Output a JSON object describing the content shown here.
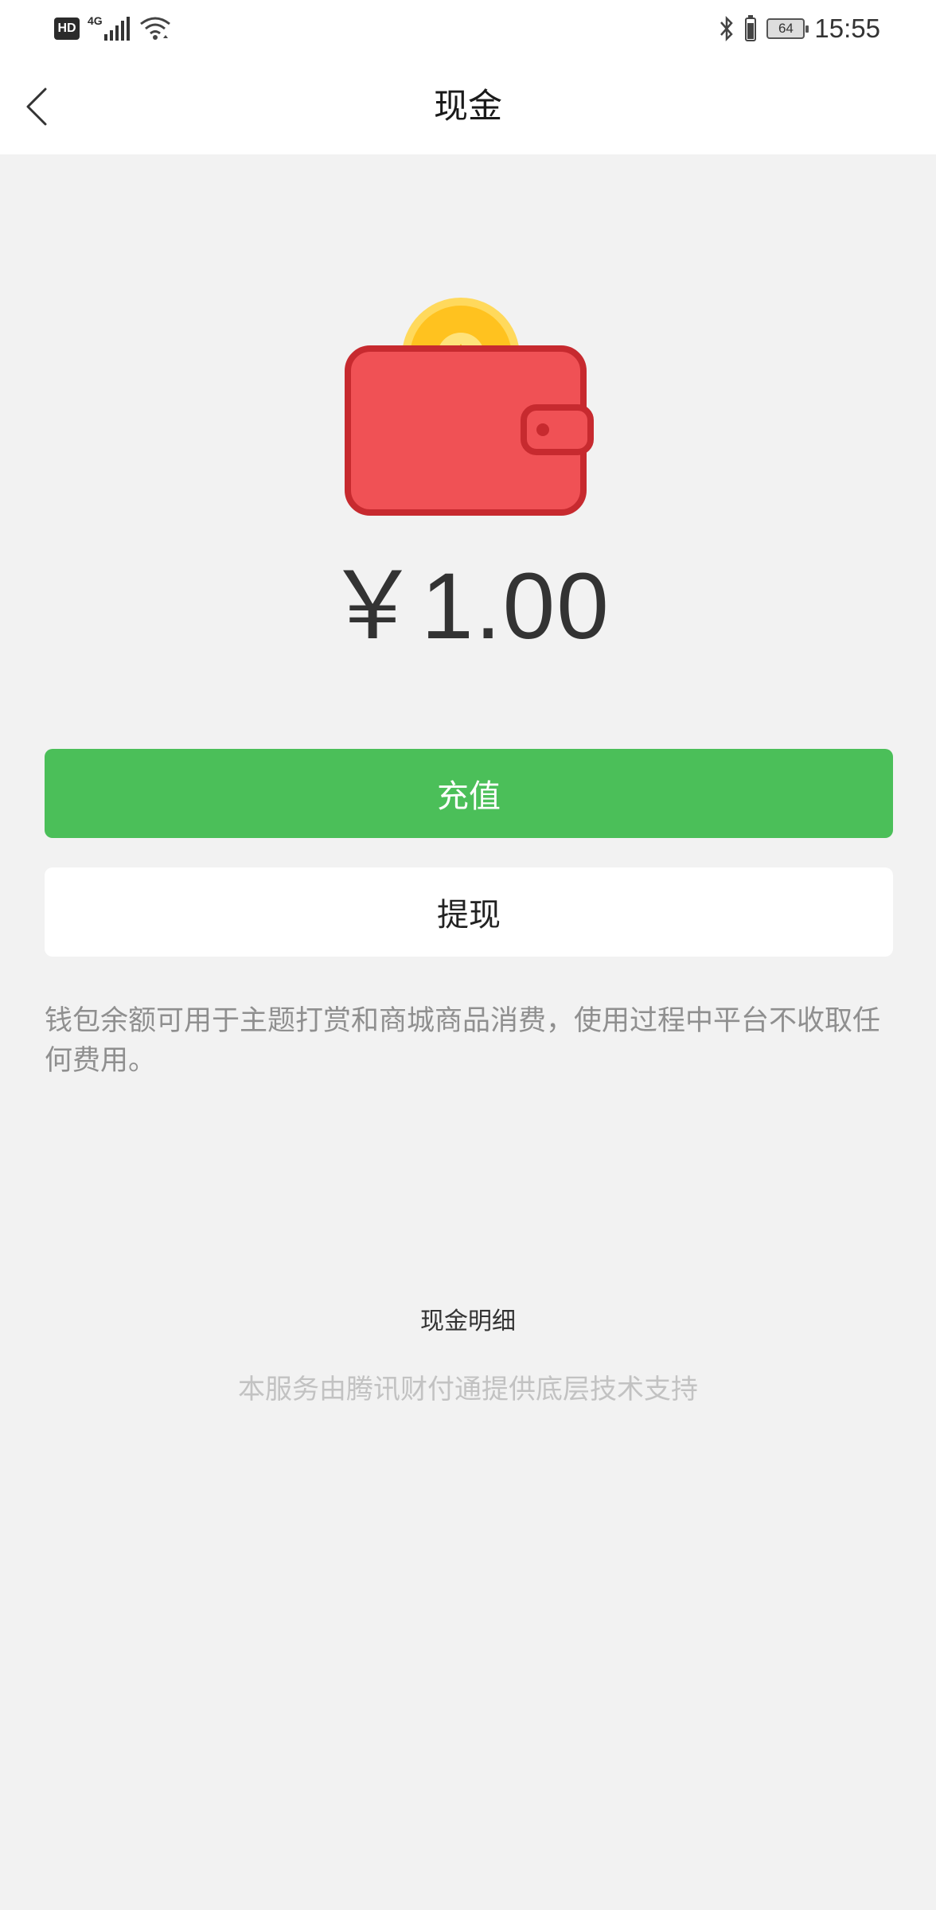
{
  "status_bar": {
    "hd_label": "HD",
    "network_label": "4G",
    "battery_level": "64",
    "time": "15:55"
  },
  "nav": {
    "title": "现金"
  },
  "wallet": {
    "balance": "￥1.00"
  },
  "actions": {
    "recharge_label": "充值",
    "withdraw_label": "提现"
  },
  "info": {
    "description": "钱包余额可用于主题打赏和商城商品消费，使用过程中平台不收取任何费用。"
  },
  "footer": {
    "detail_link": "现金明细",
    "provider_note": "本服务由腾讯财付通提供底层技术支持"
  },
  "colors": {
    "primary_green": "#4bbf59",
    "wallet_red": "#f05155",
    "coin_gold": "#ffc21f",
    "background": "#f2f2f2"
  },
  "icons": [
    "signal-icon",
    "wifi-icon",
    "bluetooth-icon",
    "battery-icon",
    "back-arrow-icon",
    "wallet-icon",
    "coin-icon",
    "star-icon"
  ]
}
